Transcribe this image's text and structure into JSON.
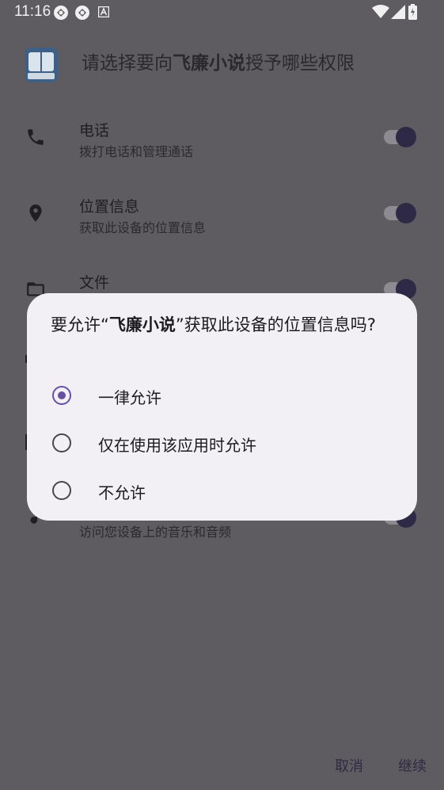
{
  "status_bar": {
    "time": "11:16",
    "icons": [
      "app-notification-icon",
      "app-notification-icon",
      "font-a-icon",
      "wifi-icon",
      "cellular-signal-icon",
      "battery-icon"
    ]
  },
  "header": {
    "title_prefix": "请选择要向",
    "app_name": "飞廉小说",
    "title_suffix": "授予哪些权限"
  },
  "permissions": [
    {
      "icon": "phone-icon",
      "title": "电话",
      "subtitle": "拨打电话和管理通话",
      "enabled": true
    },
    {
      "icon": "location-icon",
      "title": "位置信息",
      "subtitle": "获取此设备的位置信息",
      "enabled": true
    },
    {
      "icon": "folder-icon",
      "title": "文件",
      "subtitle": "",
      "enabled": true
    },
    {
      "icon": "music-note-icon",
      "title": "",
      "subtitle": "访问您设备上的音乐和音频",
      "enabled": true
    }
  ],
  "dialog": {
    "message_prefix": "要允许“",
    "app_name": "飞廉小说",
    "message_suffix": "”获取此设备的位置信息吗?",
    "options": [
      {
        "label": "一律允许",
        "selected": true
      },
      {
        "label": "仅在使用该应用时允许",
        "selected": false
      },
      {
        "label": "不允许",
        "selected": false
      }
    ]
  },
  "footer": {
    "cancel": "取消",
    "continue": "继续"
  },
  "colors": {
    "scrim_background": "#5e5c60",
    "dialog_surface": "#f2eff5",
    "accent": "#6750a4",
    "toggle_knob": "#2e2a45"
  }
}
